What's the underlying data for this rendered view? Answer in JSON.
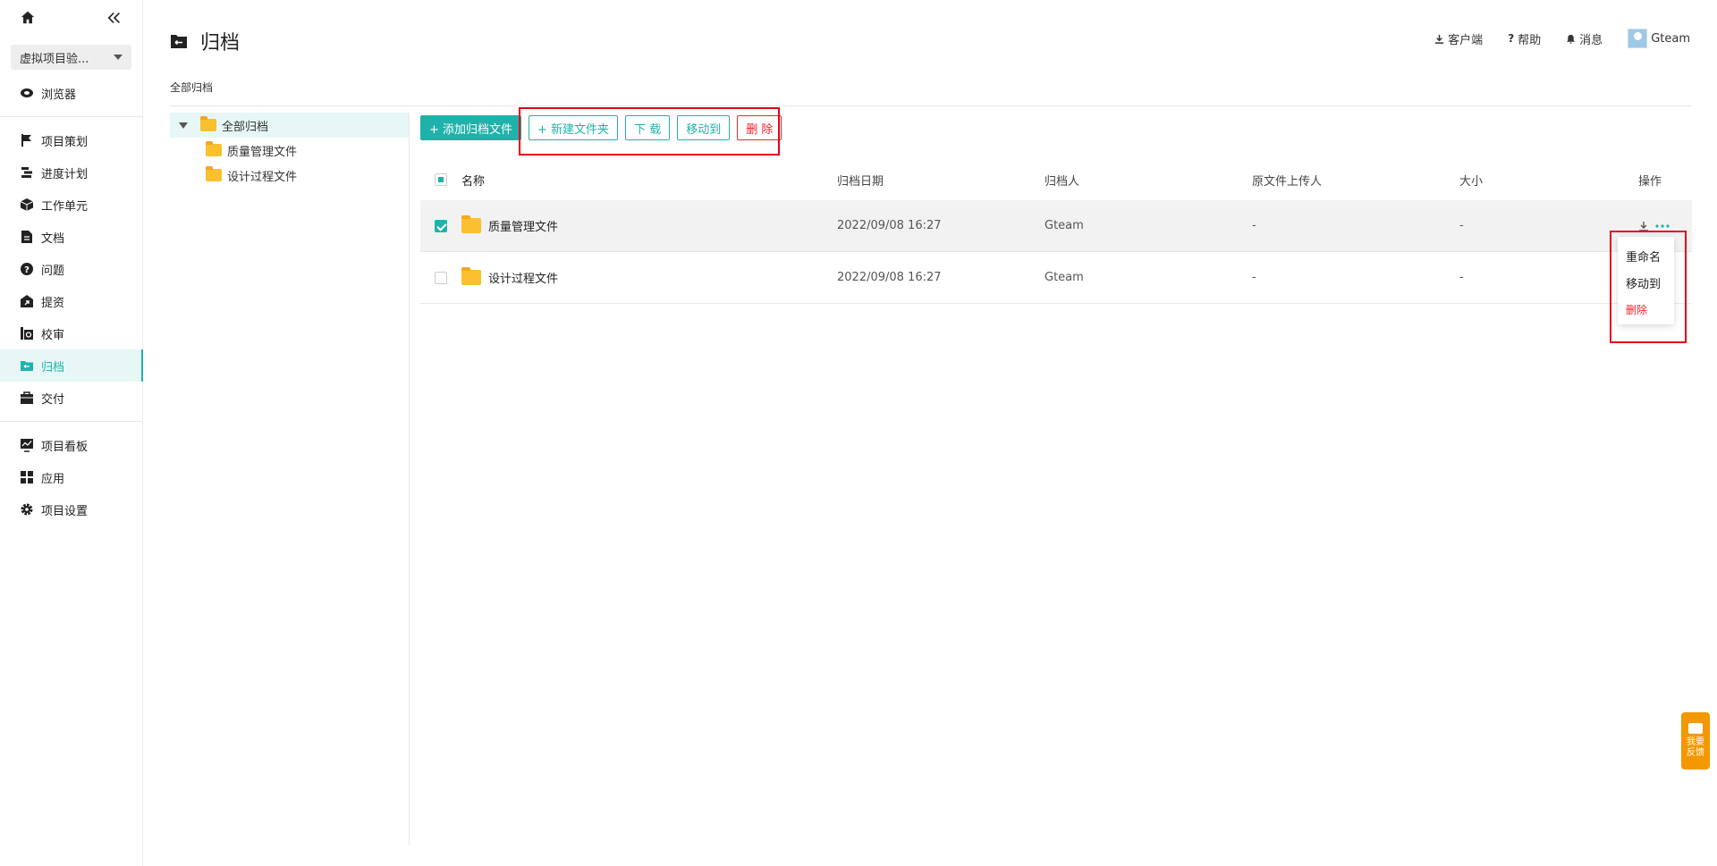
{
  "sidebar": {
    "project_name": "虚拟项目验...",
    "items": [
      {
        "label": "浏览器",
        "icon": "globe-icon"
      },
      {
        "label": "项目策划",
        "icon": "flag-icon"
      },
      {
        "label": "进度计划",
        "icon": "gantt-icon"
      },
      {
        "label": "工作单元",
        "icon": "cube-icon"
      },
      {
        "label": "文档",
        "icon": "document-icon"
      },
      {
        "label": "问题",
        "icon": "question-icon"
      },
      {
        "label": "提资",
        "icon": "submit-icon"
      },
      {
        "label": "校审",
        "icon": "review-icon"
      },
      {
        "label": "归档",
        "icon": "archive-icon"
      },
      {
        "label": "交付",
        "icon": "briefcase-icon"
      },
      {
        "label": "项目看板",
        "icon": "dashboard-icon"
      },
      {
        "label": "应用",
        "icon": "apps-icon"
      },
      {
        "label": "项目设置",
        "icon": "gear-icon"
      }
    ]
  },
  "header": {
    "title": "归档",
    "client": "客户端",
    "help": "帮助",
    "messages": "消息",
    "user": "Gteam"
  },
  "breadcrumb": "全部归档",
  "tree": {
    "root": "全部归档",
    "children": [
      "质量管理文件",
      "设计过程文件"
    ]
  },
  "toolbar": {
    "add": "+ 添加归档文件",
    "new_folder": "+ 新建文件夹",
    "download": "下 载",
    "move": "移动到",
    "delete": "删 除"
  },
  "table": {
    "headers": {
      "name": "名称",
      "date": "归档日期",
      "person": "归档人",
      "uploader": "原文件上传人",
      "size": "大小",
      "op": "操作"
    },
    "rows": [
      {
        "name": "质量管理文件",
        "date": "2022/09/08 16:27",
        "person": "Gteam",
        "uploader": "-",
        "size": "-"
      },
      {
        "name": "设计过程文件",
        "date": "2022/09/08 16:27",
        "person": "Gteam",
        "uploader": "-",
        "size": "-"
      }
    ]
  },
  "dropdown": {
    "rename": "重命名",
    "move": "移动到",
    "delete": "删除"
  },
  "feedback": {
    "line1": "我要",
    "line2": "反馈"
  },
  "colors": {
    "accent": "#20b2aa",
    "danger": "#f5222d",
    "highlight": "#e60012",
    "folder": "#fbc02d",
    "feedback": "#f39800"
  }
}
